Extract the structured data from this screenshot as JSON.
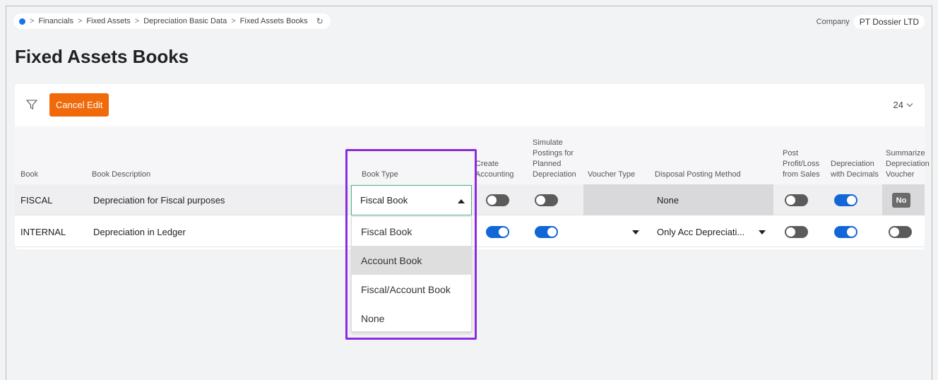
{
  "breadcrumb": {
    "items": [
      "Financials",
      "Fixed Assets",
      "Depreciation Basic Data",
      "Fixed Assets Books"
    ],
    "separator": ">"
  },
  "company": {
    "label": "Company",
    "value": "PT Dossier LTD"
  },
  "page_title": "Fixed Assets Books",
  "toolbar": {
    "cancel_label": "Cancel Edit",
    "page_size": "24"
  },
  "columns": {
    "book": "Book",
    "book_description": "Book Description",
    "book_type": "Book Type",
    "create_accounting": "Create Accounting",
    "simulate_postings": "Simulate Postings for Planned Depreciation",
    "voucher_type": "Voucher Type",
    "disposal_posting_method": "Disposal Posting Method",
    "post_profit_loss": "Post Profit/Loss from Sales",
    "depreciation_decimals": "Depreciation with Decimals",
    "summarize_voucher": "Summarize Depreciation Voucher"
  },
  "rows": [
    {
      "book": "FISCAL",
      "description": "Depreciation for Fiscal purposes",
      "book_type": "Fiscal Book",
      "create_accounting": false,
      "simulate_postings": false,
      "voucher_type": "",
      "disposal_posting_method": "None",
      "post_profit_loss": false,
      "depreciation_decimals": true,
      "summarize_voucher": "No"
    },
    {
      "book": "INTERNAL",
      "description": "Depreciation in Ledger",
      "book_type": "",
      "create_accounting": true,
      "simulate_postings": true,
      "voucher_type": "",
      "disposal_posting_method": "Only Acc Depreciati...",
      "post_profit_loss": false,
      "depreciation_decimals": true,
      "summarize_voucher": false
    }
  ],
  "book_type_options": [
    "Fiscal Book",
    "Account Book",
    "Fiscal/Account Book",
    "None"
  ],
  "book_type_highlighted": "Account Book",
  "colors": {
    "accent_orange": "#f06a0c",
    "toggle_on": "#1266d6",
    "toggle_off": "#5b5b5b",
    "annotation_purple": "#8a2be2",
    "select_border": "#4caf7c"
  }
}
